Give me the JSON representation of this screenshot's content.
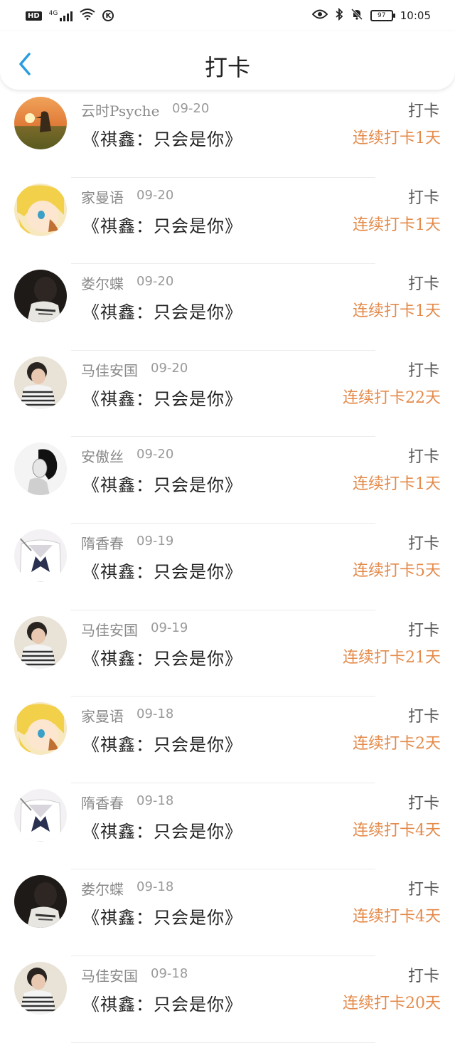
{
  "status_bar": {
    "hd": "HD",
    "network": "4G",
    "k_label": "K",
    "battery": "97",
    "time": "10:05"
  },
  "header": {
    "title": "打卡"
  },
  "list": [
    {
      "user": "云时Psyche",
      "date": "09-20",
      "book": "《祺鑫：只会是你》",
      "action": "打卡",
      "streak": "连续打卡1天",
      "avatar": "sunset-girl"
    },
    {
      "user": "家曼语",
      "date": "09-20",
      "book": "《祺鑫：只会是你》",
      "action": "打卡",
      "streak": "连续打卡1天",
      "avatar": "anime-blonde"
    },
    {
      "user": "娄尔蝶",
      "date": "09-20",
      "book": "《祺鑫：只会是你》",
      "action": "打卡",
      "streak": "连续打卡1天",
      "avatar": "dark-boy"
    },
    {
      "user": "马佳安国",
      "date": "09-20",
      "book": "《祺鑫：只会是你》",
      "action": "打卡",
      "streak": "连续打卡22天",
      "avatar": "striped-boy"
    },
    {
      "user": "安傲丝",
      "date": "09-20",
      "book": "《祺鑫：只会是你》",
      "action": "打卡",
      "streak": "连续打卡1天",
      "avatar": "bw-girl"
    },
    {
      "user": "隋香春",
      "date": "09-19",
      "book": "《祺鑫：只会是你》",
      "action": "打卡",
      "streak": "连续打卡5天",
      "avatar": "sailor-uniform"
    },
    {
      "user": "马佳安国",
      "date": "09-19",
      "book": "《祺鑫：只会是你》",
      "action": "打卡",
      "streak": "连续打卡21天",
      "avatar": "striped-boy"
    },
    {
      "user": "家曼语",
      "date": "09-18",
      "book": "《祺鑫：只会是你》",
      "action": "打卡",
      "streak": "连续打卡2天",
      "avatar": "anime-blonde"
    },
    {
      "user": "隋香春",
      "date": "09-18",
      "book": "《祺鑫：只会是你》",
      "action": "打卡",
      "streak": "连续打卡4天",
      "avatar": "sailor-uniform"
    },
    {
      "user": "娄尔蝶",
      "date": "09-18",
      "book": "《祺鑫：只会是你》",
      "action": "打卡",
      "streak": "连续打卡4天",
      "avatar": "dark-boy"
    },
    {
      "user": "马佳安国",
      "date": "09-18",
      "book": "《祺鑫：只会是你》",
      "action": "打卡",
      "streak": "连续打卡20天",
      "avatar": "striped-boy"
    }
  ],
  "colors": {
    "accent_back": "#2a9de0",
    "streak": "#e48a4a"
  }
}
